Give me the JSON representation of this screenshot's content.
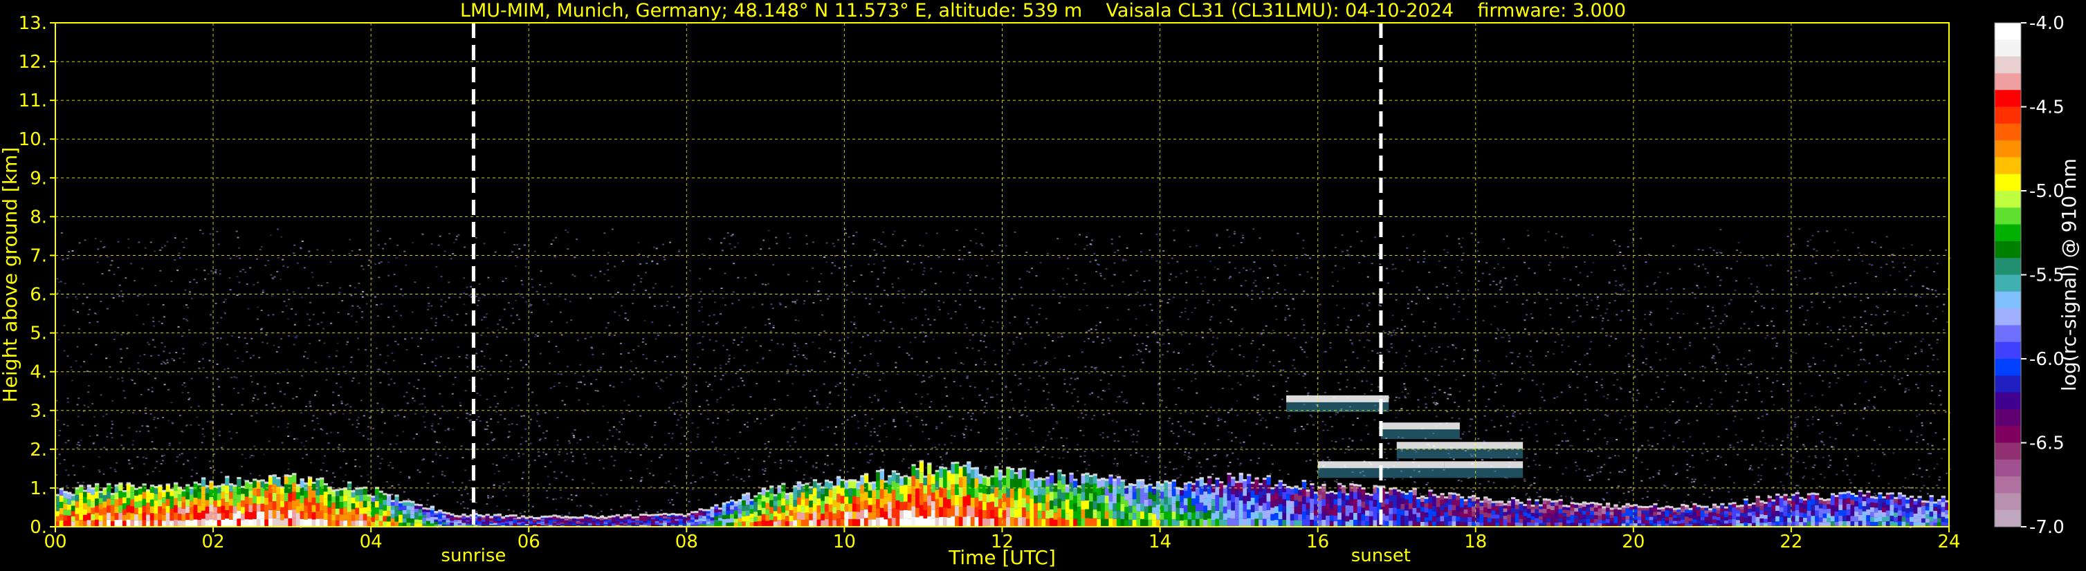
{
  "header": {
    "title": "LMU-MIM, Munich, Germany; 48.148° N 11.573° E, altitude: 539 m    Vaisala CL31 (CL31LMU): 04-10-2024    firmware: 3.000"
  },
  "colors": {
    "background": "#000000",
    "axis_text": "#ffff00",
    "grid": "#ffff00",
    "colorbar_text": "#ffffff",
    "marker_lines": "#ffffff"
  },
  "chart_data": {
    "type": "heatmap",
    "title": "LMU-MIM, Munich, Germany; 48.148° N 11.573° E, altitude: 539 m    Vaisala CL31 (CL31LMU): 04-10-2024    firmware: 3.000",
    "xlabel": "Time [UTC]",
    "ylabel": "Height above ground [km]",
    "xlim": [
      0,
      24
    ],
    "ylim": [
      0,
      13
    ],
    "x_ticks": [
      "00",
      "02",
      "04",
      "06",
      "08",
      "10",
      "12",
      "14",
      "16",
      "18",
      "20",
      "22",
      "24"
    ],
    "y_ticks": [
      "0.",
      "1.",
      "2.",
      "3.",
      "4.",
      "5.",
      "6.",
      "7.",
      "8.",
      "9.",
      "10.",
      "11.",
      "12.",
      "13."
    ],
    "grid": true,
    "markers": [
      {
        "label": "sunrise",
        "time_utc": 5.3
      },
      {
        "label": "sunset",
        "time_utc": 16.8
      }
    ],
    "signal_top_km": 7.7,
    "colorbar": {
      "label": "log(rc-signal) @ 910 nm",
      "range": [
        -7.0,
        -4.0
      ],
      "ticks": [
        "-4.0",
        "-4.5",
        "-5.0",
        "-5.5",
        "-6.0",
        "-6.5",
        "-7.0"
      ],
      "colors": [
        "#ffffff",
        "#f4f4f4",
        "#e8d0d0",
        "#f0a0a0",
        "#ff0000",
        "#ff3000",
        "#ff6000",
        "#ff9000",
        "#ffc000",
        "#ffff00",
        "#c0ff40",
        "#60e030",
        "#00b000",
        "#008000",
        "#209070",
        "#40b0b0",
        "#80c0ff",
        "#a0b0ff",
        "#7070ff",
        "#4040ff",
        "#0040ff",
        "#2020c0",
        "#400090",
        "#600070",
        "#800060",
        "#903070",
        "#a05090",
        "#b070a0",
        "#b890b0",
        "#c0a8c0"
      ]
    },
    "profile": {
      "time_utc": [
        0,
        1,
        2,
        3,
        4,
        5,
        6,
        7,
        8,
        9,
        10,
        11,
        12,
        13,
        14,
        15,
        16,
        17,
        18,
        19,
        20,
        21,
        22,
        23,
        24
      ],
      "layer_top_km": [
        0.9,
        1.0,
        1.1,
        1.2,
        0.9,
        0.3,
        0.25,
        0.25,
        0.3,
        0.9,
        1.2,
        1.5,
        1.4,
        1.2,
        1.1,
        1.2,
        1.0,
        0.9,
        0.7,
        0.6,
        0.5,
        0.5,
        0.8,
        0.8,
        0.7
      ],
      "intensity": [
        0.8,
        0.9,
        0.95,
        0.95,
        0.8,
        0.4,
        0.3,
        0.3,
        0.35,
        0.8,
        0.9,
        0.95,
        0.85,
        0.7,
        0.6,
        0.45,
        0.35,
        0.35,
        0.3,
        0.25,
        0.3,
        0.3,
        0.4,
        0.4,
        0.45
      ]
    },
    "cloud_layers": [
      {
        "start_utc": 15.6,
        "end_utc": 16.9,
        "height_km": 3.3
      },
      {
        "start_utc": 16.0,
        "end_utc": 17.6,
        "height_km": 1.6
      },
      {
        "start_utc": 16.8,
        "end_utc": 17.8,
        "height_km": 2.6
      },
      {
        "start_utc": 17.6,
        "end_utc": 18.6,
        "height_km": 1.6
      },
      {
        "start_utc": 17.0,
        "end_utc": 18.6,
        "height_km": 2.1
      }
    ]
  }
}
